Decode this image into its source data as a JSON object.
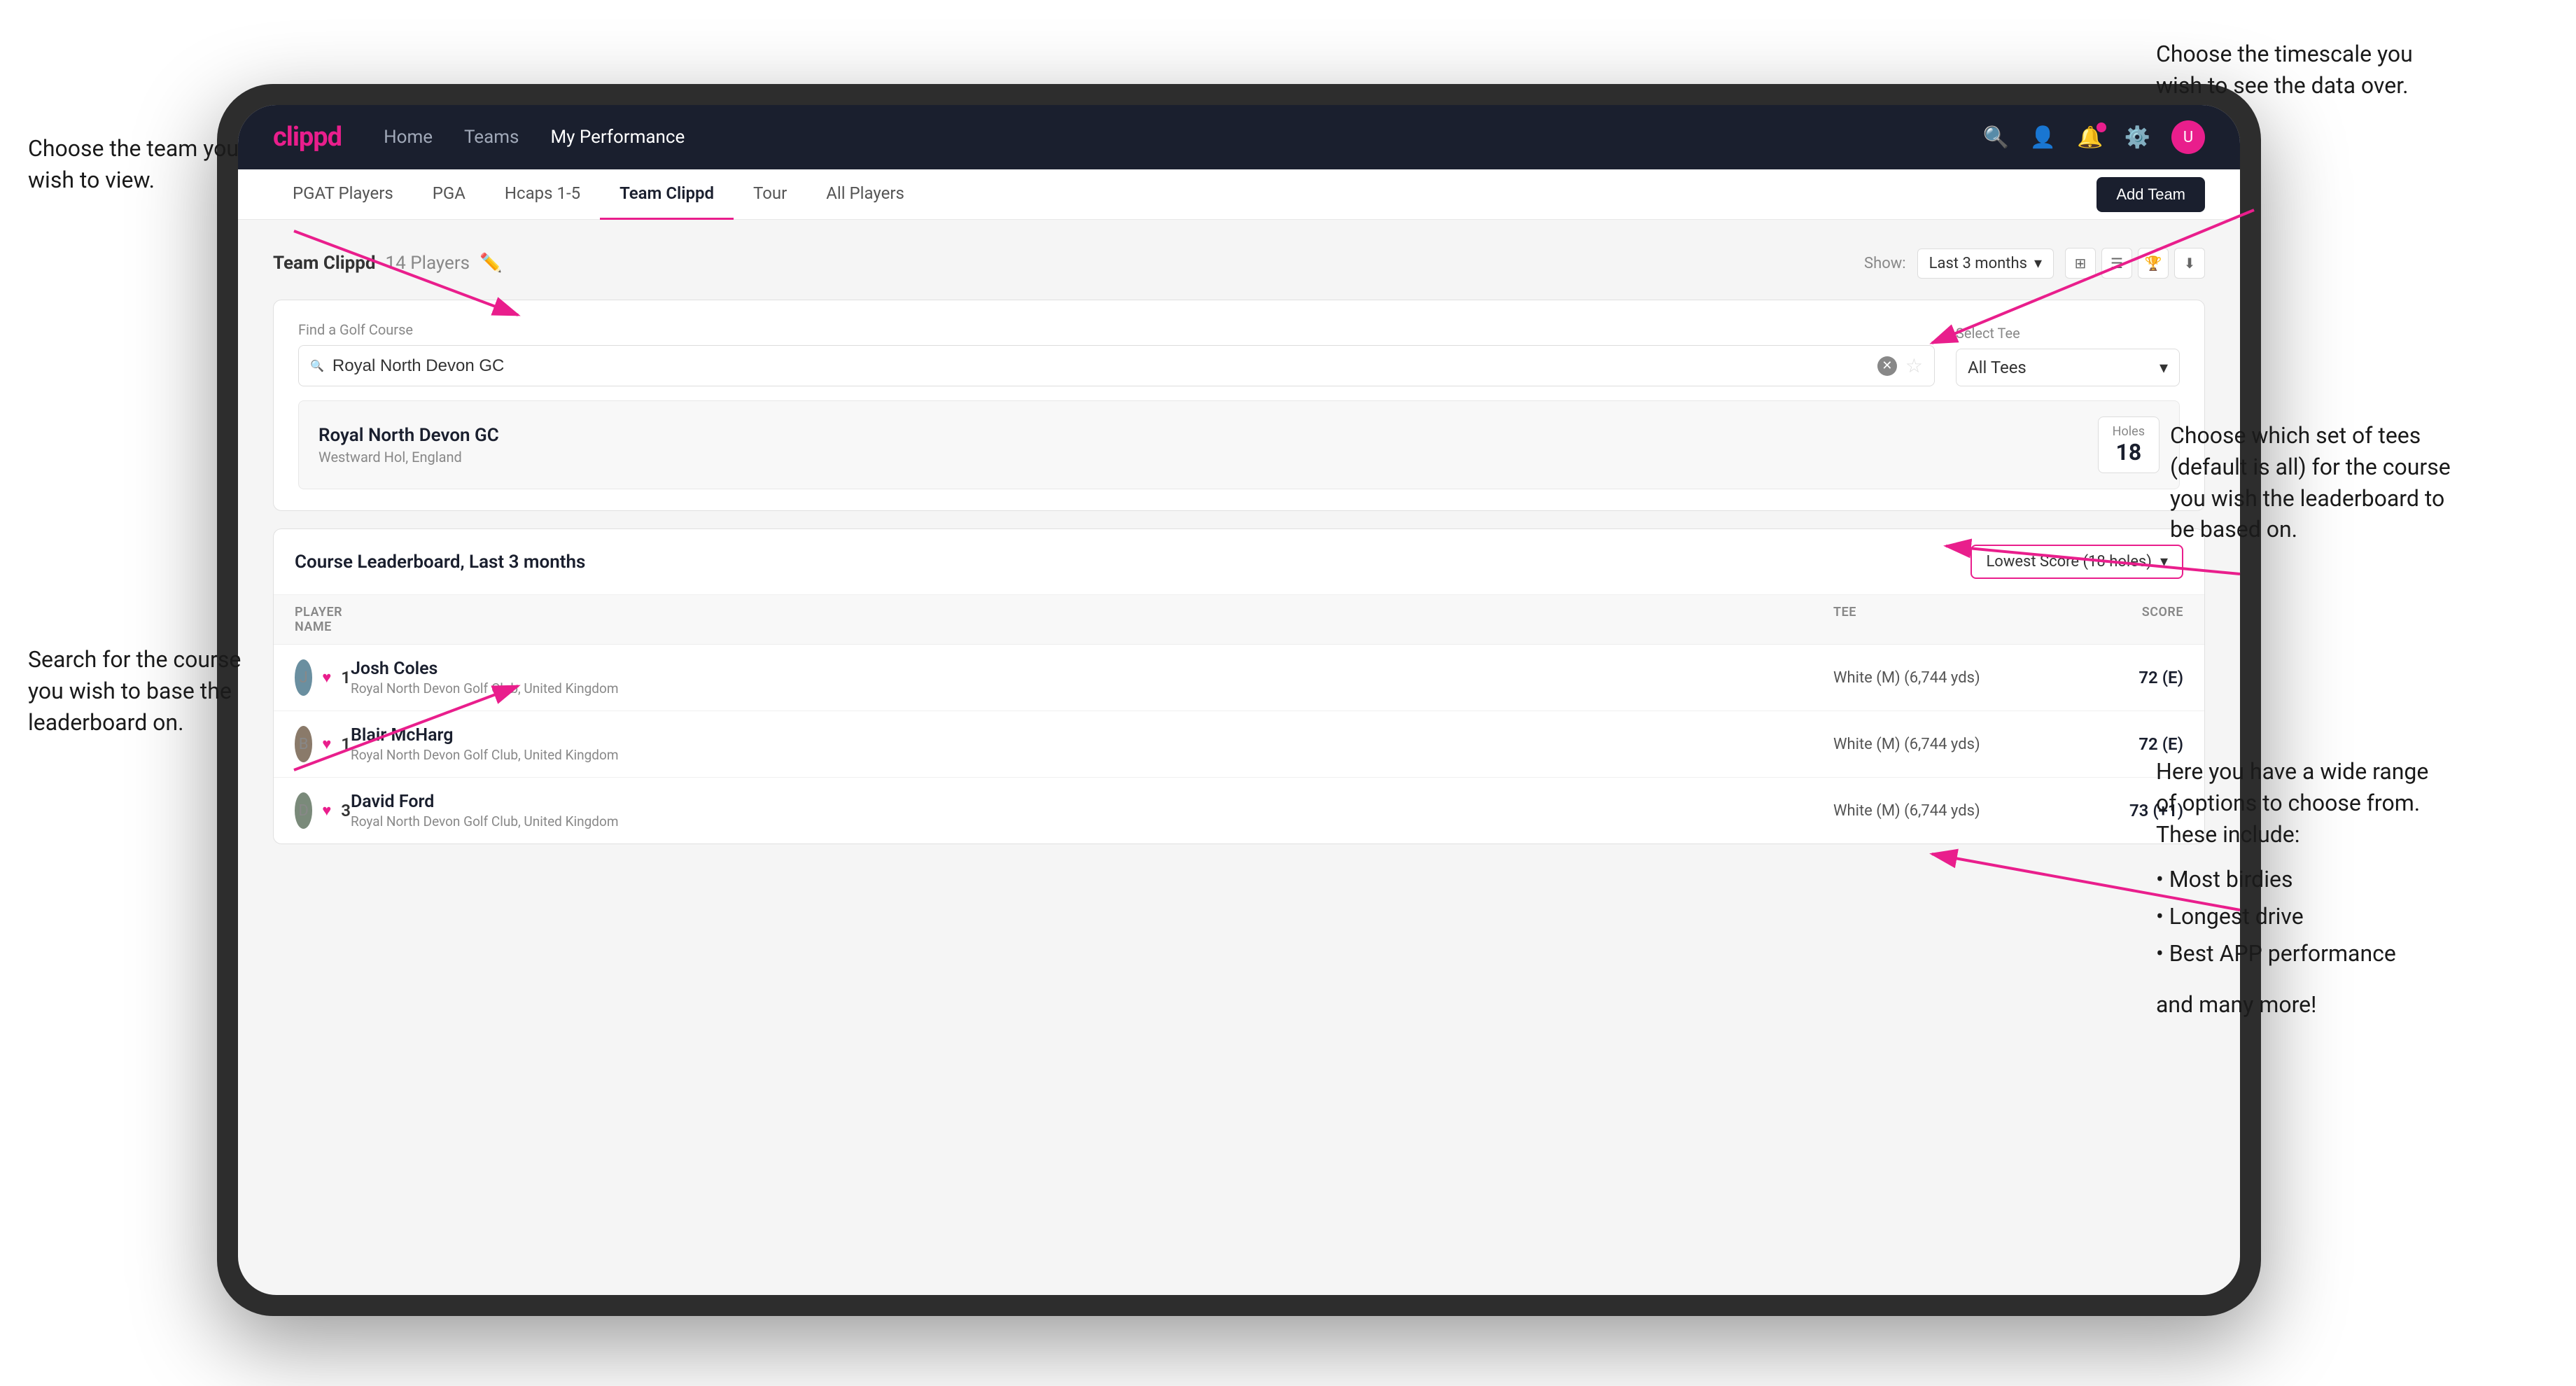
{
  "annotations": {
    "top_left_heading": "Choose the team you\nwish to view.",
    "bottom_left_heading": "Search for the course\nyou wish to base the\nleaderboard on.",
    "top_right_heading": "Choose the timescale you\nwish to see the data over.",
    "mid_right_heading": "Choose which set of tees\n(default is all) for the course\nyou wish the leaderboard to\nbe based on.",
    "bottom_right_heading": "Here you have a wide range\nof options to choose from.\nThese include:",
    "bullet_items": [
      "Most birdies",
      "Longest drive",
      "Best APP performance"
    ],
    "and_more": "and many more!"
  },
  "nav": {
    "logo": "clippd",
    "links": [
      {
        "label": "Home",
        "active": false
      },
      {
        "label": "Teams",
        "active": false
      },
      {
        "label": "My Performance",
        "active": true
      }
    ]
  },
  "sub_nav": {
    "items": [
      {
        "label": "PGAT Players",
        "active": false
      },
      {
        "label": "PGA",
        "active": false
      },
      {
        "label": "Hcaps 1-5",
        "active": false
      },
      {
        "label": "Team Clippd",
        "active": true
      },
      {
        "label": "Tour",
        "active": false
      },
      {
        "label": "All Players",
        "active": false
      }
    ],
    "add_team_button": "Add Team"
  },
  "team_header": {
    "title": "Team Clippd",
    "player_count": "14 Players",
    "show_label": "Show:",
    "time_period": "Last 3 months"
  },
  "search_area": {
    "find_label": "Find a Golf Course",
    "search_placeholder": "Royal North Devon GC",
    "tee_label": "Select Tee",
    "tee_value": "All Tees"
  },
  "course_result": {
    "name": "Royal North Devon GC",
    "location": "Westward Hol, England",
    "holes_label": "Holes",
    "holes_value": "18"
  },
  "leaderboard": {
    "title": "Course Leaderboard",
    "subtitle": "Last 3 months",
    "score_type": "Lowest Score (18 holes)",
    "columns": [
      "PLAYER NAME",
      "TEE",
      "SCORE"
    ],
    "players": [
      {
        "rank": "1",
        "name": "Josh Coles",
        "club": "Royal North Devon Golf Club, United Kingdom",
        "tee": "White (M) (6,744 yds)",
        "score": "72 (E)"
      },
      {
        "rank": "1",
        "name": "Blair McHarg",
        "club": "Royal North Devon Golf Club, United Kingdom",
        "tee": "White (M) (6,744 yds)",
        "score": "72 (E)"
      },
      {
        "rank": "3",
        "name": "David Ford",
        "club": "Royal North Devon Golf Club, United Kingdom",
        "tee": "White (M) (6,744 yds)",
        "score": "73 (+1)"
      }
    ]
  },
  "colors": {
    "brand_pink": "#e91e8c",
    "nav_dark": "#1a1f2e",
    "accent": "#e91e8c"
  }
}
